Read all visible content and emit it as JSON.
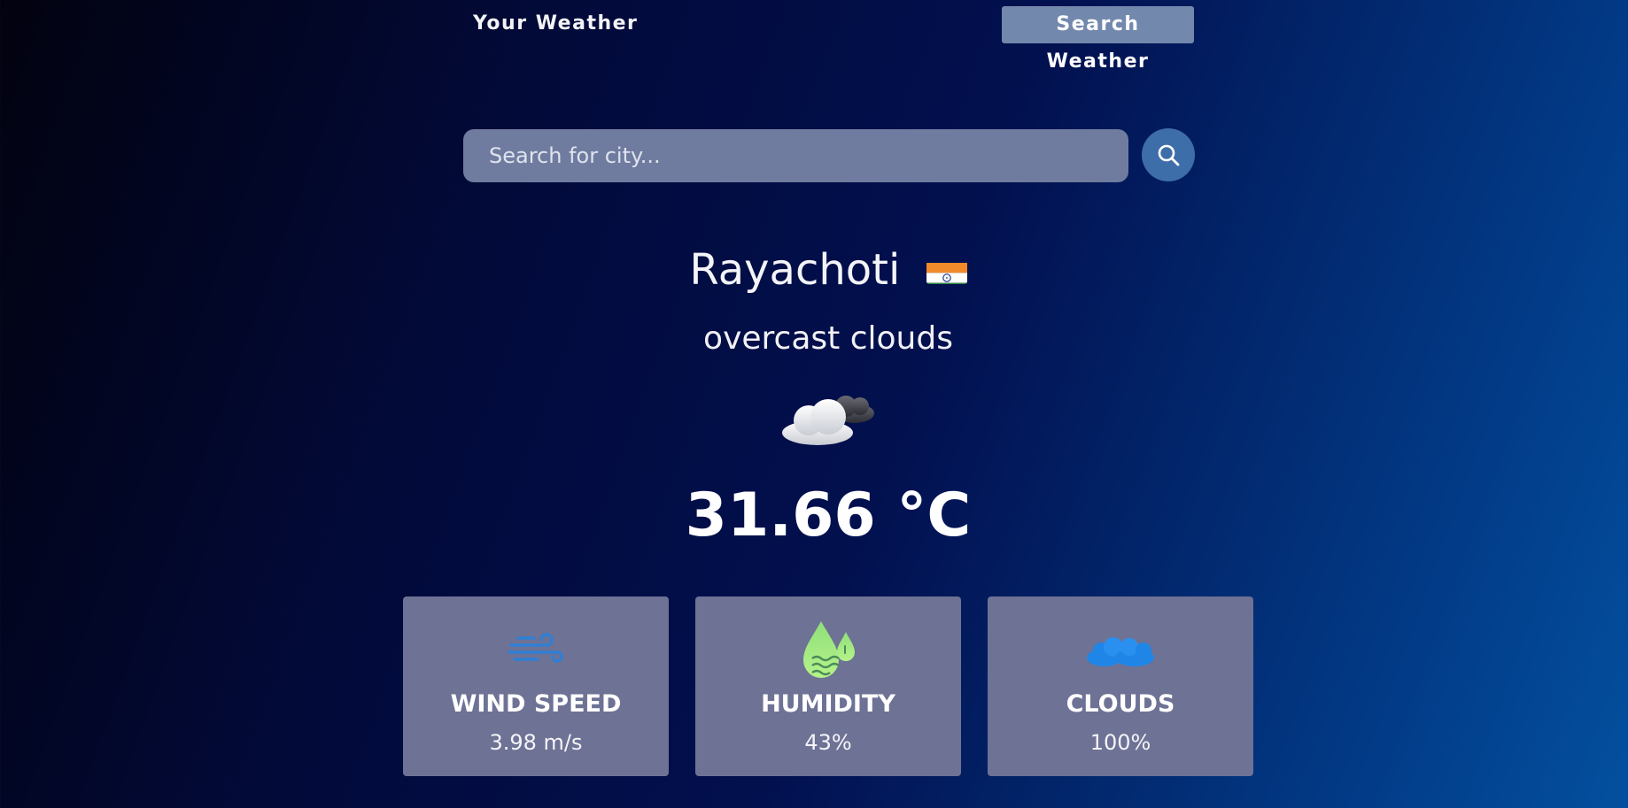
{
  "nav": {
    "your_weather": "Your Weather",
    "search_weather": "Search Weather"
  },
  "search": {
    "placeholder": "Search for city...",
    "value": ""
  },
  "weather": {
    "city": "Rayachoti",
    "country_flag": "india-flag-icon",
    "description": "overcast clouds",
    "condition_icon": "overcast-clouds-icon",
    "temperature": "31.66 °C"
  },
  "cards": [
    {
      "icon": "wind-icon",
      "title": "WIND SPEED",
      "value": "3.98 m/s"
    },
    {
      "icon": "humidity-icon",
      "title": "HUMIDITY",
      "value": "43%"
    },
    {
      "icon": "clouds-icon",
      "title": "CLOUDS",
      "value": "100%"
    }
  ],
  "colors": {
    "active_tab": "#7388ad",
    "search_button": "#3e6eaa",
    "card_background": "#6e7295"
  }
}
